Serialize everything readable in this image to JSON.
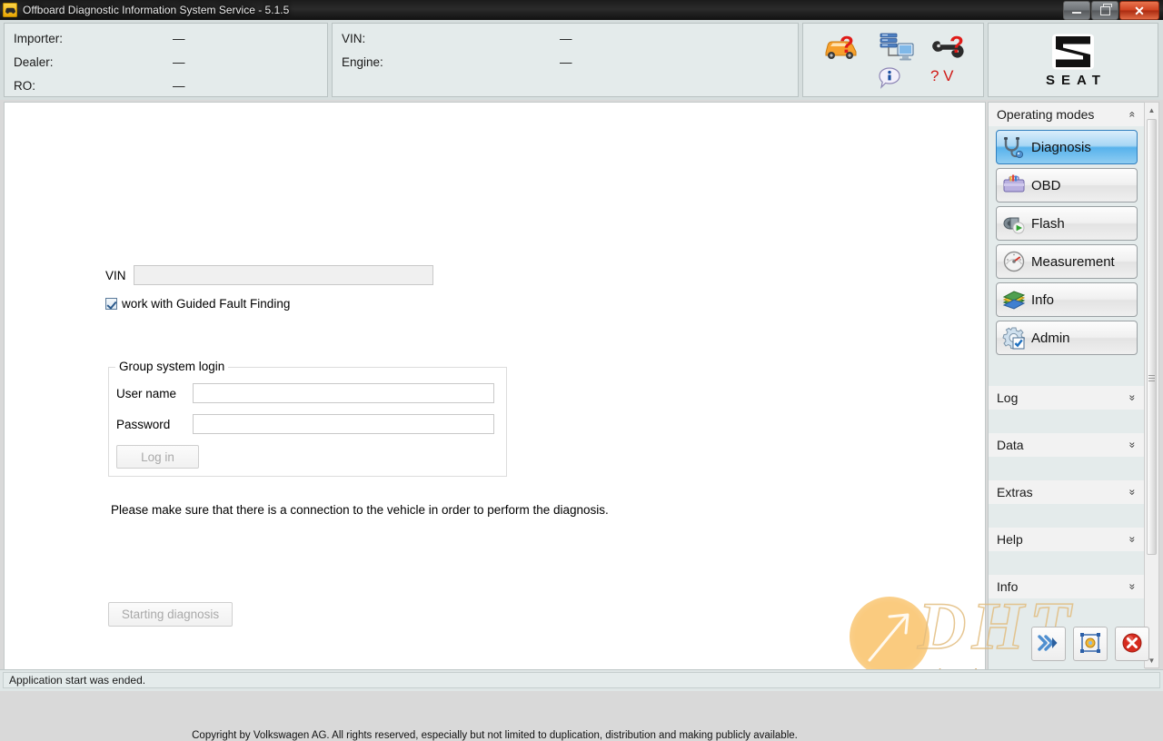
{
  "window": {
    "title": "Offboard Diagnostic Information System Service - 5.1.5",
    "app_icon": "car-icon",
    "minimize_label": "Minimize",
    "restore_label": "Restore",
    "close_label": "Close"
  },
  "header": {
    "left_panel": {
      "rows": [
        {
          "label": "Importer:",
          "value": "—"
        },
        {
          "label": "Dealer:",
          "value": "—"
        },
        {
          "label": "RO:",
          "value": "—"
        }
      ]
    },
    "vehicle_panel": {
      "rows": [
        {
          "label": "VIN:",
          "value": "—"
        },
        {
          "label": "Engine:",
          "value": "—"
        }
      ]
    },
    "status_icons": [
      {
        "name": "vehicle-connection-icon",
        "tooltip": "Vehicle connection unknown"
      },
      {
        "name": "server-connection-icon",
        "tooltip": "Server connection"
      },
      {
        "name": "license-key-icon",
        "tooltip": "License unknown"
      },
      {
        "name": "info-balloon-icon",
        "tooltip": "Information"
      },
      {
        "name": "version-indicator",
        "label": "? V"
      }
    ],
    "brand": {
      "logo": "seat-logo",
      "wordmark": "SEAT"
    }
  },
  "main": {
    "vin": {
      "label": "VIN",
      "value": "",
      "placeholder": ""
    },
    "guided_fault_finding": {
      "label": "work with Guided Fault Finding",
      "checked": true
    },
    "group_login": {
      "legend": "Group system login",
      "username": {
        "label": "User name",
        "value": "",
        "placeholder": ""
      },
      "password": {
        "label": "Password",
        "value": "",
        "placeholder": ""
      },
      "login_button": {
        "label": "Log in",
        "enabled": false
      }
    },
    "note": "Please make sure that there is a connection to the vehicle in order to perform the diagnosis.",
    "start_button": {
      "label": "Starting diagnosis",
      "enabled": false
    },
    "copyright": "Copyright by Volkswagen AG. All rights reserved, especially but not limited to duplication, distribution and making publicly available."
  },
  "sidebar": {
    "title": "Operating modes",
    "title_chevron": "«",
    "modes": [
      {
        "label": "Diagnosis",
        "icon": "stethoscope-icon",
        "selected": true
      },
      {
        "label": "OBD",
        "icon": "toolbox-icon",
        "selected": false
      },
      {
        "label": "Flash",
        "icon": "flash-drive-icon",
        "selected": false
      },
      {
        "label": "Measurement",
        "icon": "gauge-icon",
        "selected": false
      },
      {
        "label": "Info",
        "icon": "books-icon",
        "selected": false
      },
      {
        "label": "Admin",
        "icon": "gear-check-icon",
        "selected": false
      }
    ],
    "sections": [
      {
        "label": "Log",
        "chevron": "»"
      },
      {
        "label": "Data",
        "chevron": "»"
      },
      {
        "label": "Extras",
        "chevron": "»"
      },
      {
        "label": "Help",
        "chevron": "»"
      },
      {
        "label": "Info",
        "chevron": "»"
      }
    ],
    "scroll": {
      "up_arrow": "▲",
      "down_arrow": "▼"
    }
  },
  "toolbar": {
    "buttons": [
      {
        "name": "forward-button",
        "icon": "double-chevron-right-icon",
        "label": "Forward"
      },
      {
        "name": "screenshot-button",
        "icon": "capture-icon",
        "label": "Screenshot"
      },
      {
        "name": "cancel-button",
        "icon": "red-x-icon",
        "label": "Cancel"
      }
    ]
  },
  "statusbar": {
    "message": "Application start was ended."
  },
  "watermark": {
    "brand": "DHT",
    "tagline": "Sharing creates success"
  }
}
